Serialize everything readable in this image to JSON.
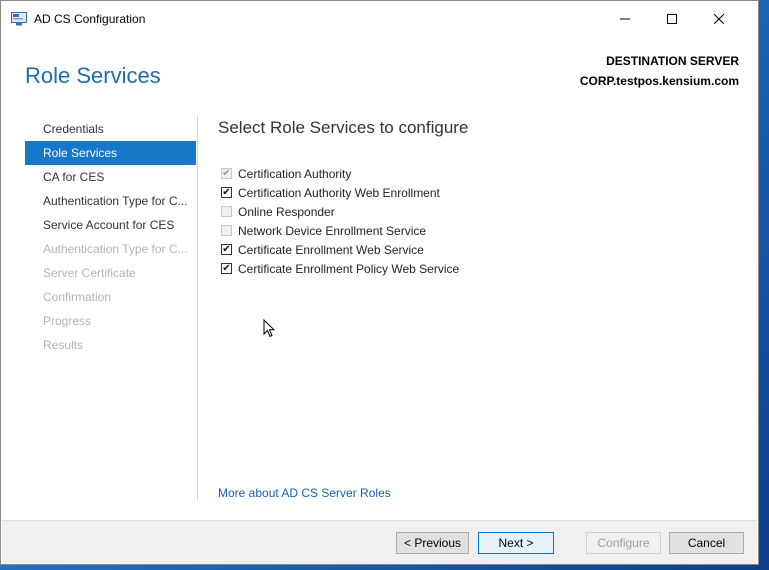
{
  "window": {
    "title": "AD CS Configuration"
  },
  "header": {
    "page_title": "Role Services",
    "destination_label": "DESTINATION SERVER",
    "destination_server": "CORP.testpos.kensium.com"
  },
  "nav": {
    "items": [
      {
        "label": "Credentials",
        "state": "normal"
      },
      {
        "label": "Role Services",
        "state": "active"
      },
      {
        "label": "CA for CES",
        "state": "normal"
      },
      {
        "label": "Authentication Type for C...",
        "state": "normal"
      },
      {
        "label": "Service Account for CES",
        "state": "normal"
      },
      {
        "label": "Authentication Type for C...",
        "state": "disabled"
      },
      {
        "label": "Server Certificate",
        "state": "disabled"
      },
      {
        "label": "Confirmation",
        "state": "disabled"
      },
      {
        "label": "Progress",
        "state": "disabled"
      },
      {
        "label": "Results",
        "state": "disabled"
      }
    ]
  },
  "main": {
    "section_title": "Select Role Services to configure",
    "services": [
      {
        "label": "Certification Authority",
        "checked": true,
        "disabled": true
      },
      {
        "label": "Certification Authority Web Enrollment",
        "checked": true,
        "disabled": false
      },
      {
        "label": "Online Responder",
        "checked": false,
        "disabled": false
      },
      {
        "label": "Network Device Enrollment Service",
        "checked": false,
        "disabled": false
      },
      {
        "label": "Certificate Enrollment Web Service",
        "checked": true,
        "disabled": false
      },
      {
        "label": "Certificate Enrollment Policy Web Service",
        "checked": true,
        "disabled": false
      }
    ],
    "more_link": "More about AD CS Server Roles"
  },
  "footer": {
    "previous": "< Previous",
    "next": "Next >",
    "configure": "Configure",
    "cancel": "Cancel"
  },
  "colors": {
    "accent": "#1777c9",
    "title": "#1d6ea8",
    "link": "#1a5fa8"
  }
}
